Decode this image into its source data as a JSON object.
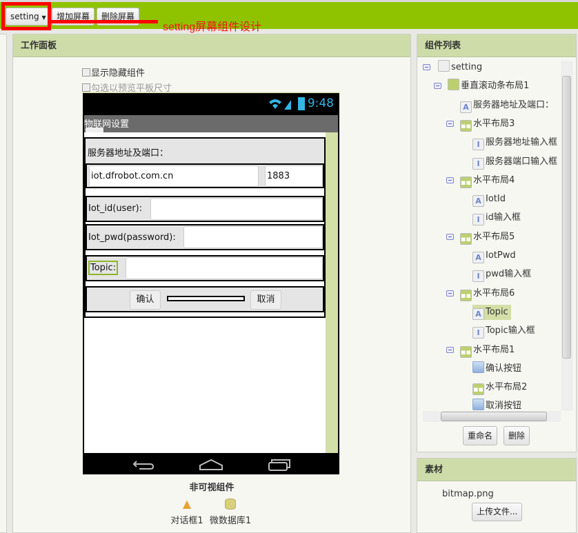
{
  "toolbar": {
    "screen_select": "setting",
    "add_screen": "增加屏幕",
    "remove_screen": "删除屏幕"
  },
  "annotation": "setting屏幕组件设计",
  "viewer": {
    "title": "工作面板",
    "show_hidden": "显示隐藏组件",
    "tablet_preview": "勾选以预览平板尺寸",
    "phone": {
      "time": "9:48",
      "app_title": "物联网设置",
      "server_label": "服务器地址及端口：",
      "server_value": "iot.dfrobot.com.cn",
      "port_value": "1883",
      "id_label": "Iot_id(user):",
      "pwd_label": "Iot_pwd(password):",
      "topic_label": "Topic:",
      "confirm": "确认",
      "cancel": "取消"
    },
    "nonvisible_title": "非可视组件",
    "nonvisible": [
      {
        "label": "对话框1",
        "icon": "warning-icon"
      },
      {
        "label": "微数据库1",
        "icon": "database-icon"
      }
    ]
  },
  "components": {
    "title": "组件列表",
    "tree": [
      {
        "label": "setting",
        "icon": "screen-icon"
      },
      {
        "label": "垂直滚动条布局1",
        "icon": "vertical-arrangement-icon"
      },
      {
        "label": "服务器地址及端口：",
        "icon": "label-icon"
      },
      {
        "label": "水平布局3",
        "icon": "horizontal-arrangement-icon"
      },
      {
        "label": "服务器地址输入框",
        "icon": "textbox-icon"
      },
      {
        "label": "服务器端口输入框",
        "icon": "textbox-icon"
      },
      {
        "label": "水平布局4",
        "icon": "horizontal-arrangement-icon"
      },
      {
        "label": "IotId",
        "icon": "label-icon"
      },
      {
        "label": "id输入框",
        "icon": "textbox-icon"
      },
      {
        "label": "水平布局5",
        "icon": "horizontal-arrangement-icon"
      },
      {
        "label": "IotPwd",
        "icon": "label-icon"
      },
      {
        "label": "pwd输入框",
        "icon": "textbox-icon"
      },
      {
        "label": "水平布局6",
        "icon": "horizontal-arrangement-icon"
      },
      {
        "label": "Topic",
        "icon": "label-icon",
        "selected": true
      },
      {
        "label": "Topic输入框",
        "icon": "textbox-icon"
      },
      {
        "label": "水平布局1",
        "icon": "horizontal-arrangement-icon"
      },
      {
        "label": "确认按钮",
        "icon": "button-icon"
      },
      {
        "label": "水平布局2",
        "icon": "horizontal-arrangement-icon"
      },
      {
        "label": "取消按钮",
        "icon": "button-icon"
      }
    ],
    "rename": "重命名",
    "delete": "删除"
  },
  "assets": {
    "title": "素材",
    "file": "bitmap.png",
    "upload": "上传文件..."
  }
}
